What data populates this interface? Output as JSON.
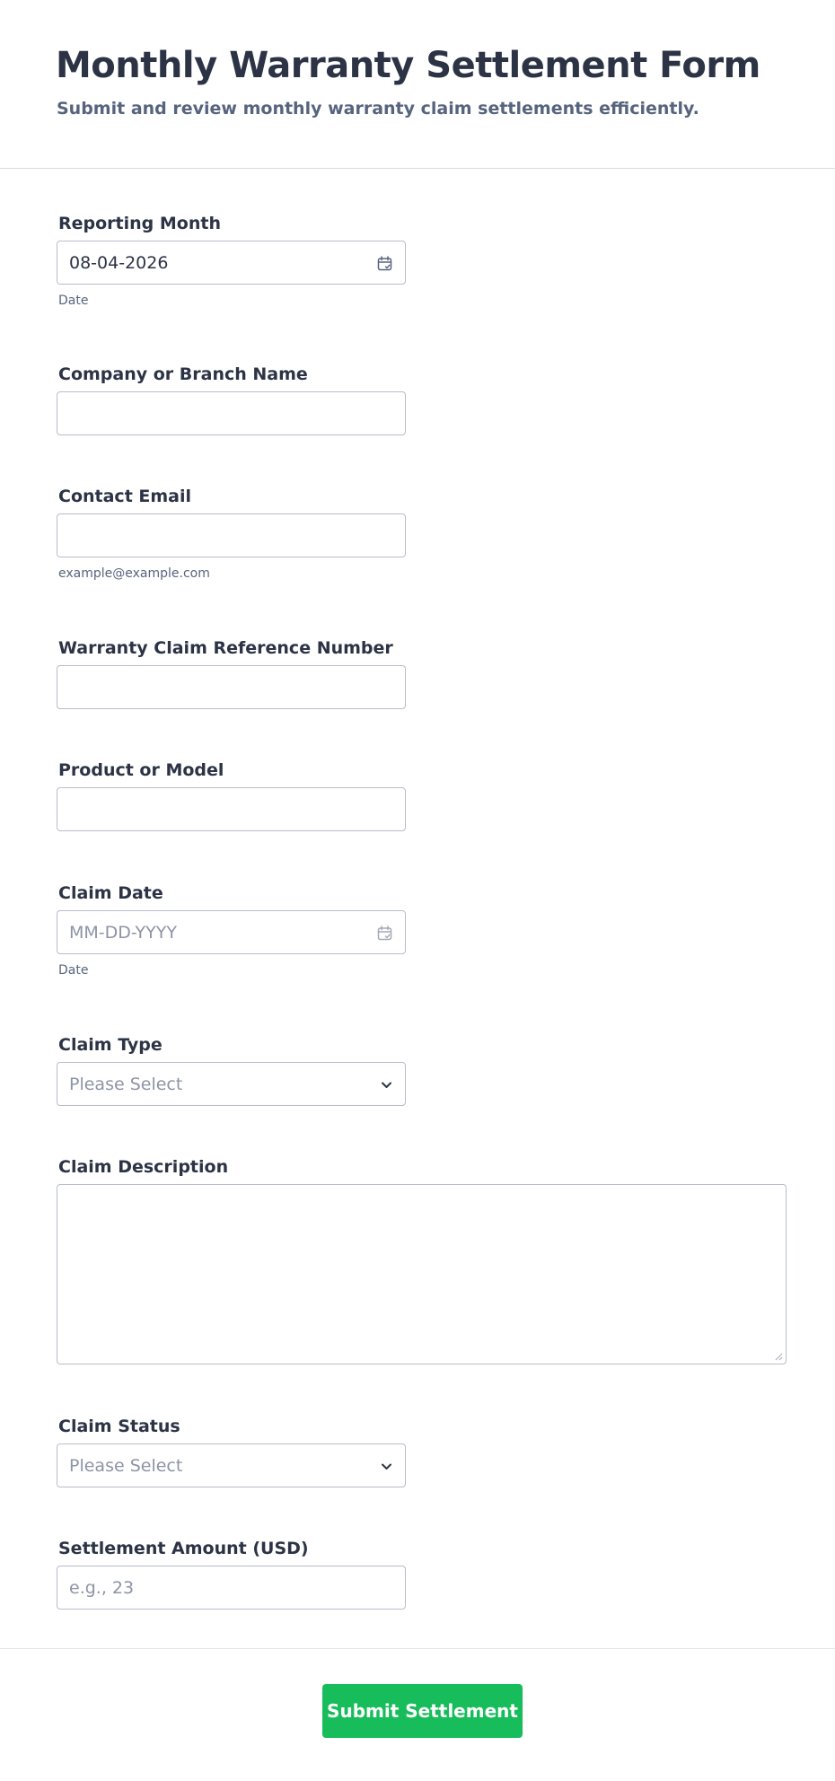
{
  "header": {
    "title": "Monthly Warranty Settlement Form",
    "subtitle": "Submit and review monthly warranty claim settlements efficiently."
  },
  "form": {
    "reporting_month": {
      "label": "Reporting Month",
      "value": "08-04-2026",
      "sublabel": "Date",
      "icon": "calendar-icon"
    },
    "company_name": {
      "label": "Company or Branch Name",
      "value": ""
    },
    "contact_email": {
      "label": "Contact Email",
      "value": "",
      "sublabel": "example@example.com"
    },
    "claim_reference": {
      "label": "Warranty Claim Reference Number",
      "value": ""
    },
    "product_model": {
      "label": "Product or Model",
      "value": ""
    },
    "claim_date": {
      "label": "Claim Date",
      "placeholder": "MM-DD-YYYY",
      "sublabel": "Date",
      "icon": "calendar-icon"
    },
    "claim_type": {
      "label": "Claim Type",
      "placeholder": "Please Select",
      "icon": "chevron-down-icon"
    },
    "claim_description": {
      "label": "Claim Description",
      "value": ""
    },
    "claim_status": {
      "label": "Claim Status",
      "placeholder": "Please Select",
      "icon": "chevron-down-icon"
    },
    "settlement_amount": {
      "label": "Settlement Amount (USD)",
      "placeholder": "e.g., 23"
    }
  },
  "footer": {
    "submit_label": "Submit Settlement"
  },
  "colors": {
    "accent": "#18bd5b",
    "text": "#2c3345",
    "muted": "#57647e",
    "border": "#b8bdc9"
  }
}
